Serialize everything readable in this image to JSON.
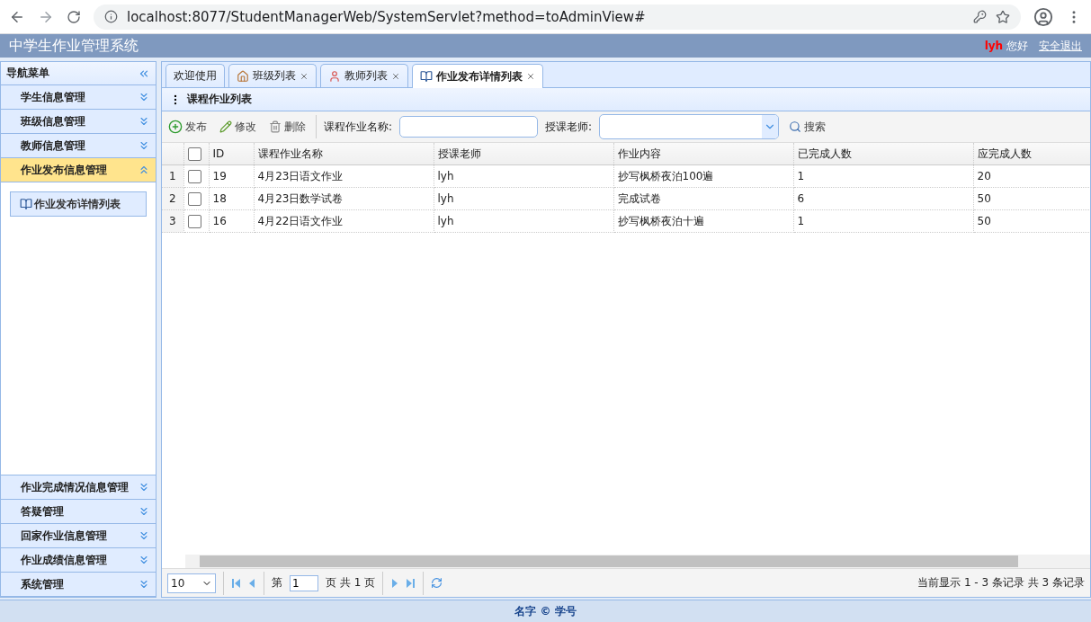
{
  "browser": {
    "url": "localhost:8077/StudentManagerWeb/SystemServlet?method=toAdminView#"
  },
  "header": {
    "title": "中学生作业管理系统",
    "user": "lyh",
    "greeting": "您好",
    "logout": "安全退出"
  },
  "sidebar": {
    "title": "导航菜单",
    "sections": [
      {
        "label": "学生信息管理",
        "expanded": false
      },
      {
        "label": "班级信息管理",
        "expanded": false
      },
      {
        "label": "教师信息管理",
        "expanded": false
      },
      {
        "label": "作业发布信息管理",
        "expanded": true,
        "children": [
          {
            "label": "作业发布详情列表",
            "selected": true
          }
        ]
      },
      {
        "label": "作业完成情况信息管理",
        "expanded": false
      },
      {
        "label": "答疑管理",
        "expanded": false
      },
      {
        "label": "回家作业信息管理",
        "expanded": false
      },
      {
        "label": "作业成绩信息管理",
        "expanded": false
      },
      {
        "label": "系统管理",
        "expanded": false
      }
    ]
  },
  "tabs": [
    {
      "label": "欢迎使用",
      "kind": "plain",
      "selected": false,
      "closable": false
    },
    {
      "label": "班级列表",
      "kind": "house",
      "selected": false,
      "closable": true
    },
    {
      "label": "教师列表",
      "kind": "person",
      "selected": false,
      "closable": true
    },
    {
      "label": "作业发布详情列表",
      "kind": "book",
      "selected": true,
      "closable": true
    }
  ],
  "panel": {
    "title": "课程作业列表",
    "toolbar": [
      {
        "label": "发布",
        "kind": "add"
      },
      {
        "label": "修改",
        "kind": "edit"
      },
      {
        "label": "删除",
        "kind": "delete"
      }
    ],
    "filters": [
      {
        "label": "课程作业名称:",
        "kind": "text"
      },
      {
        "label": "授课老师:",
        "kind": "select"
      }
    ],
    "search": "搜索",
    "columns": [
      "ID",
      "课程作业名称",
      "授课老师",
      "作业内容",
      "已完成人数",
      "应完成人数"
    ],
    "all_checked": false,
    "rows": [
      {
        "number": "1",
        "checked": false,
        "cells": [
          "19",
          "4月23日语文作业",
          "lyh",
          "抄写枫桥夜泊100遍",
          "1",
          "20"
        ]
      },
      {
        "number": "2",
        "checked": false,
        "cells": [
          "18",
          "4月23日数学试卷",
          "lyh",
          "完成试卷",
          "6",
          "50"
        ]
      },
      {
        "number": "3",
        "checked": false,
        "cells": [
          "16",
          "4月22日语文作业",
          "lyh",
          "抄写枫桥夜泊十遍",
          "1",
          "50"
        ]
      }
    ],
    "pager": {
      "page_size": "10",
      "page_before": "第",
      "page": "1",
      "page_after": "页 共 1 页",
      "summary": "当前显示 1 - 3 条记录 共 3 条记录"
    }
  },
  "footer": "名字 © 学号"
}
